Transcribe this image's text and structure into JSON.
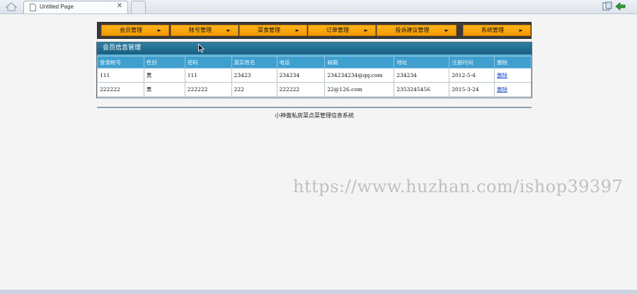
{
  "browser": {
    "tab_title": "Untitled Page",
    "close_glyph": "✕"
  },
  "menu": {
    "arrow_glyph": "►",
    "items": [
      {
        "label": "会员管理"
      },
      {
        "label": "帐号管理"
      },
      {
        "label": "菜食管理"
      },
      {
        "label": "订单管理"
      },
      {
        "label": "投诉建议管理"
      },
      {
        "label": "系统管理"
      }
    ]
  },
  "panel": {
    "title": "会员信息管理"
  },
  "table": {
    "headers": [
      "登录帐号",
      "性别",
      "密码",
      "真实姓名",
      "电话",
      "邮箱",
      "地址",
      "注册时间",
      "删除"
    ],
    "rows": [
      [
        "111",
        "男",
        "111",
        "23423",
        "234234",
        "234234234@qq.com",
        "234234",
        "2012-5-4",
        "删除"
      ],
      [
        "222222",
        "男",
        "222222",
        "222",
        "222222",
        "22@126.com",
        "2353245456",
        "2015-3-24",
        "删除"
      ]
    ]
  },
  "footer": {
    "text": "小神傲私房菜点菜管理信息系统"
  },
  "watermark": "https://www.huzhan.com/ishop39397",
  "colors": {
    "menu_orange": "#f39a00",
    "panel_blue": "#1b5f80",
    "header_blue": "#3f9fce",
    "link_blue": "#1a4fd0"
  }
}
